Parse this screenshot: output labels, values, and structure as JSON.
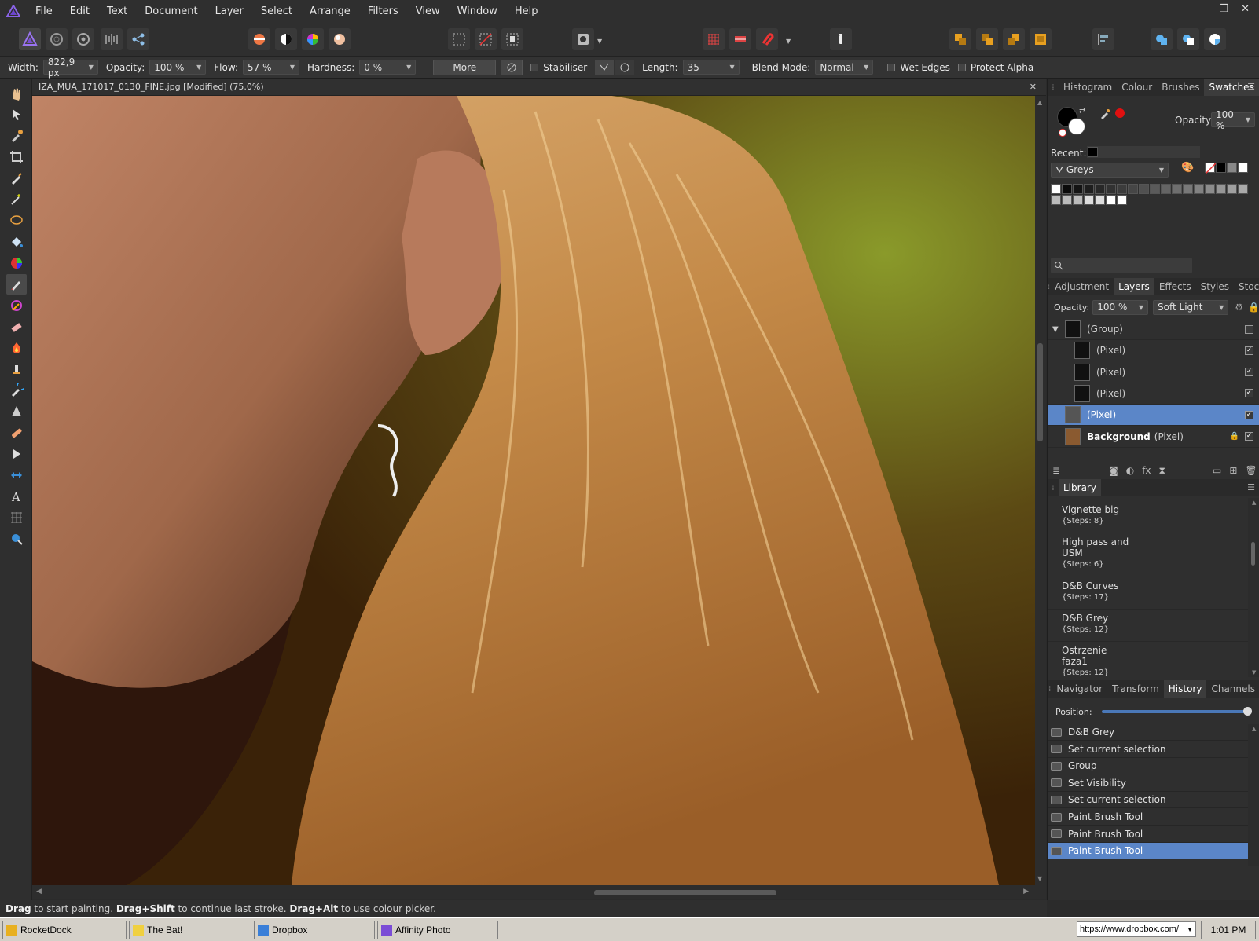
{
  "menubar": {
    "items": [
      "File",
      "Edit",
      "Text",
      "Document",
      "Layer",
      "Select",
      "Arrange",
      "Filters",
      "View",
      "Window",
      "Help"
    ]
  },
  "window_controls": {
    "minimize": "–",
    "restore": "❐",
    "close": "✕"
  },
  "context_toolbar": {
    "width_label": "Width:",
    "width_value": "822,9 px",
    "opacity_label": "Opacity:",
    "opacity_value": "100 %",
    "flow_label": "Flow:",
    "flow_value": "57 %",
    "hardness_label": "Hardness:",
    "hardness_value": "0 %",
    "more_label": "More",
    "stabiliser_label": "Stabiliser",
    "length_label": "Length:",
    "length_value": "35",
    "blend_label": "Blend Mode:",
    "blend_value": "Normal",
    "wet_edges_label": "Wet Edges",
    "protect_alpha_label": "Protect Alpha"
  },
  "document": {
    "title": "IZA_MUA_171017_0130_FINE.jpg [Modified] (75.0%)",
    "close": "✕"
  },
  "status": {
    "k1": "Drag",
    "t1": " to start painting. ",
    "k2": "Drag+Shift",
    "t2": " to continue last stroke. ",
    "k3": "Drag+Alt",
    "t3": " to use colour picker."
  },
  "colour_panel": {
    "tabs": [
      "Histogram",
      "Colour",
      "Brushes",
      "Swatches"
    ],
    "active_tab": "Swatches",
    "opacity_label": "Opacity:",
    "opacity_value": "100 %",
    "recent_label": "Recent:",
    "palette_name": "Greys"
  },
  "layers_panel": {
    "tabs": [
      "Adjustment",
      "Layers",
      "Effects",
      "Styles",
      "Stock"
    ],
    "active_tab": "Layers",
    "opacity_label": "Opacity:",
    "opacity_value": "100 %",
    "blend_value": "Soft Light",
    "layers": [
      {
        "name": "(Group)",
        "indent": 0,
        "checked": false,
        "selected": false
      },
      {
        "name": "(Pixel)",
        "indent": 1,
        "checked": true,
        "selected": false
      },
      {
        "name": "(Pixel)",
        "indent": 1,
        "checked": true,
        "selected": false
      },
      {
        "name": "(Pixel)",
        "indent": 1,
        "checked": true,
        "selected": false
      },
      {
        "name": "(Pixel)",
        "indent": 0,
        "checked": true,
        "selected": true
      },
      {
        "name": "Background",
        "suffix": "(Pixel)",
        "indent": 0,
        "checked": true,
        "selected": false,
        "locked": true
      }
    ]
  },
  "library_panel": {
    "title": "Library",
    "items": [
      {
        "name": "Vignette big",
        "steps": "{Steps: 8}"
      },
      {
        "name": "High pass and USM",
        "steps": "{Steps: 6}"
      },
      {
        "name": "D&B Curves",
        "steps": "{Steps: 17}"
      },
      {
        "name": "D&B Grey",
        "steps": "{Steps: 12}"
      },
      {
        "name": "Ostrzenie faza1",
        "steps": "{Steps: 12}"
      }
    ]
  },
  "history_panel": {
    "tabs": [
      "Navigator",
      "Transform",
      "History",
      "Channels"
    ],
    "active_tab": "History",
    "position_label": "Position:",
    "items": [
      "D&B Grey",
      "Set current selection",
      "Group",
      "Set Visibility",
      "Set current selection",
      "Paint Brush Tool",
      "Paint Brush Tool",
      "Paint Brush Tool"
    ],
    "selected_index": 7
  },
  "taskbar": {
    "tasks": [
      "RocketDock",
      "The Bat!",
      "Dropbox",
      "Affinity Photo"
    ],
    "address": "https://www.dropbox.com/",
    "clock": "1:01 PM"
  },
  "colors": {
    "accent": "#5b86c8",
    "brand": "#7b4dd6",
    "swatch_red": "#e01010"
  }
}
